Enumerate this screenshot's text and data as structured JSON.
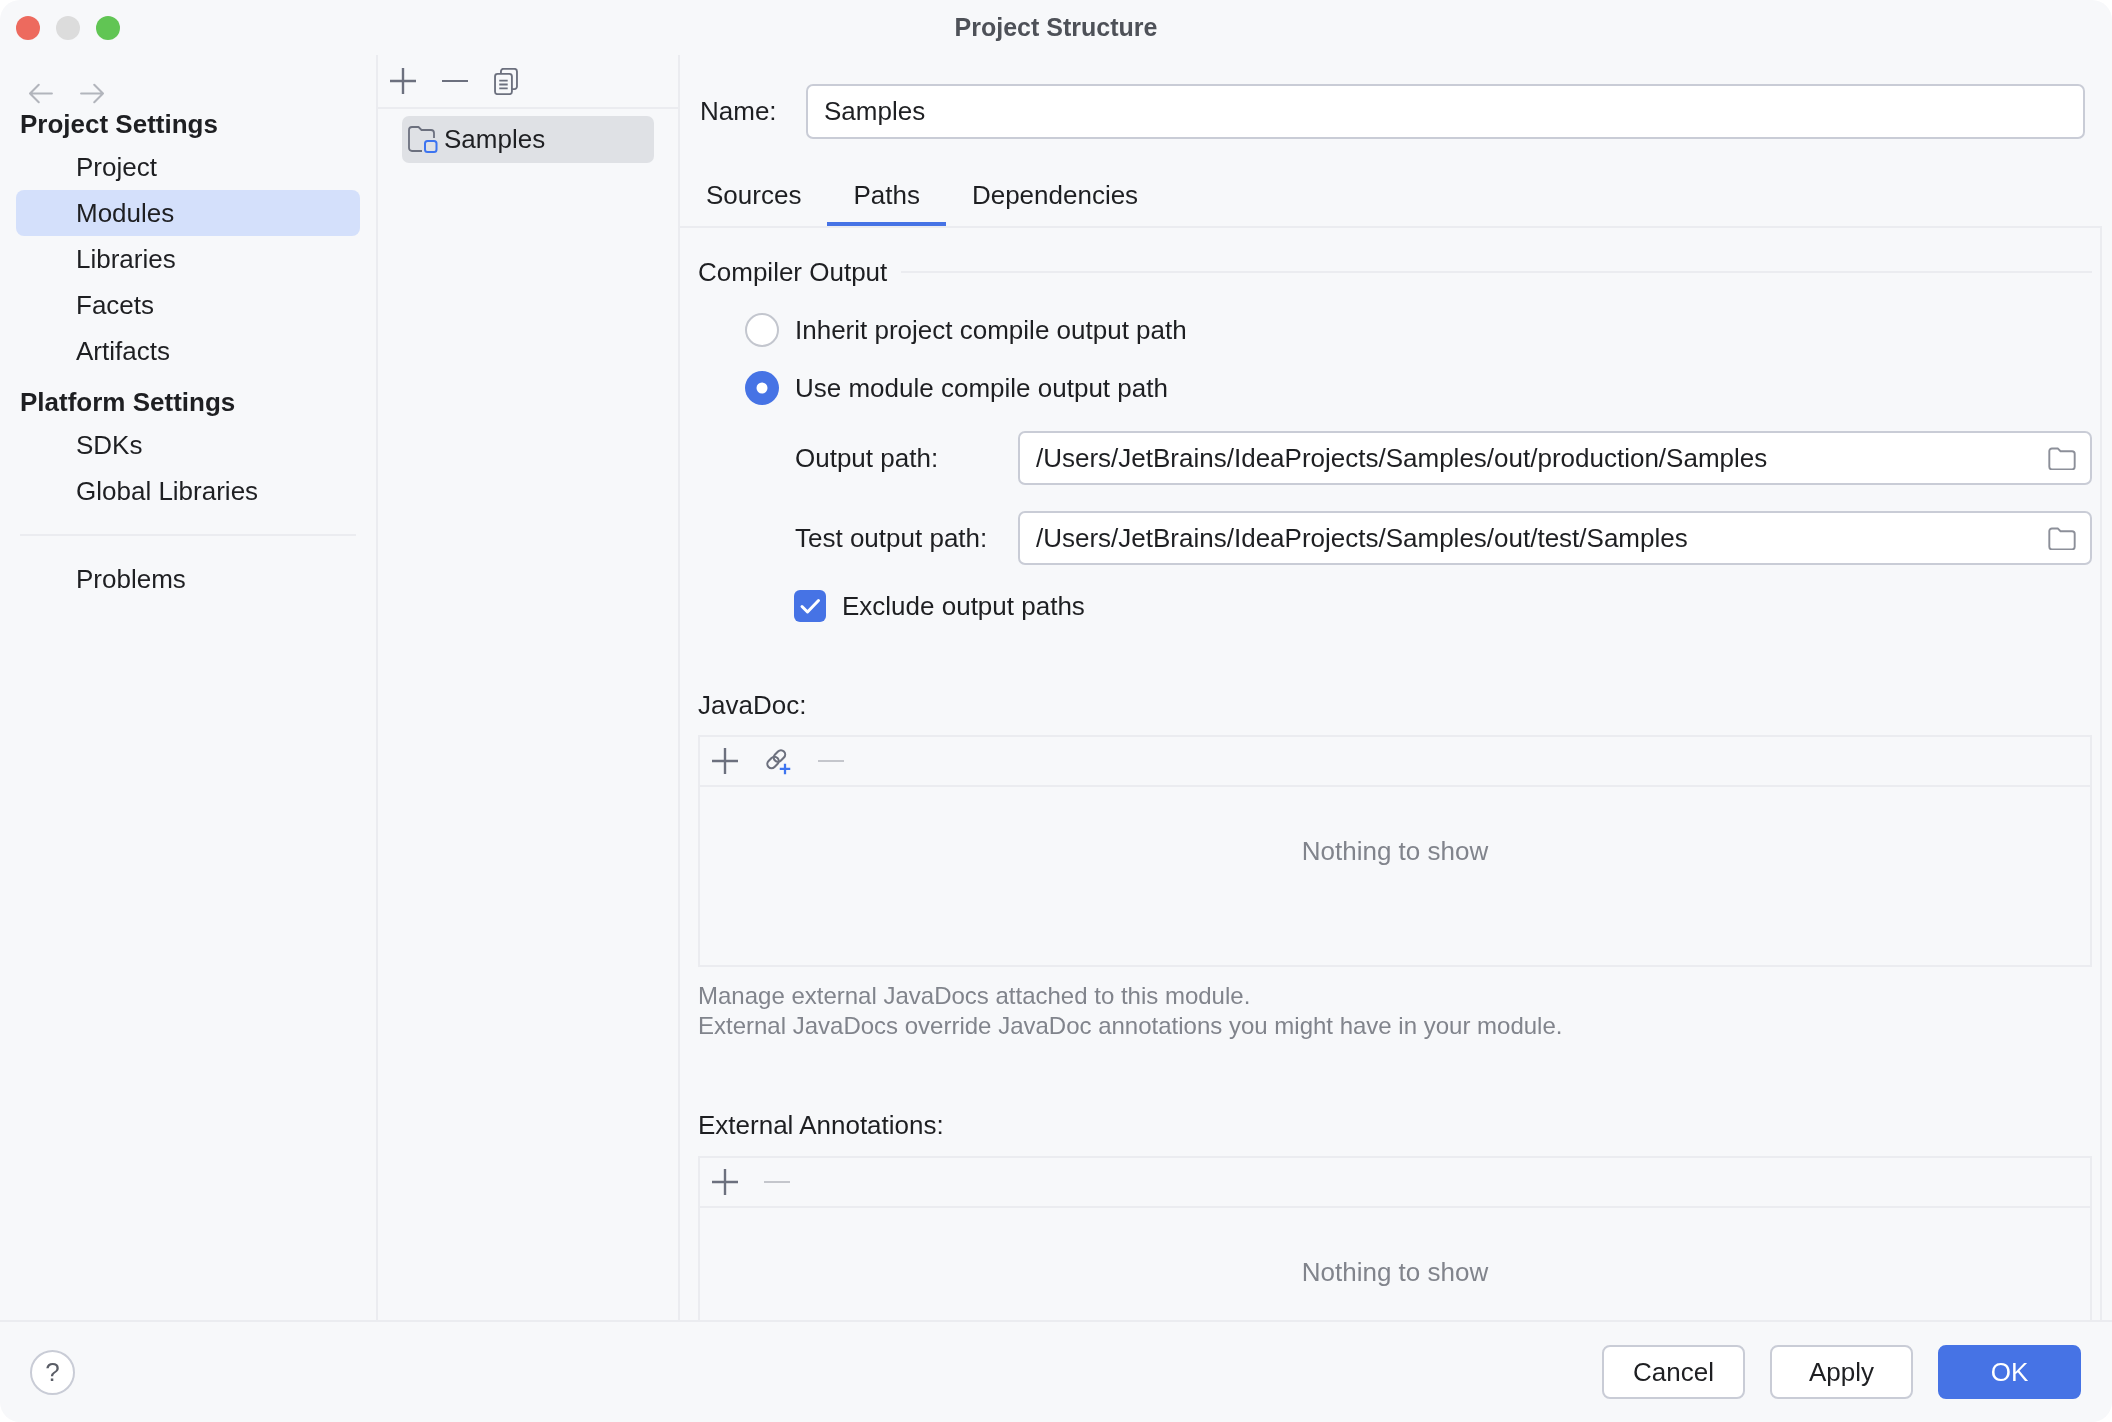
{
  "window": {
    "title": "Project Structure",
    "controls": [
      {
        "kind": "close",
        "disabled": false
      },
      {
        "kind": "minimize",
        "disabled": true
      },
      {
        "kind": "zoom",
        "disabled": false
      }
    ]
  },
  "navigation": [
    {
      "kind": "back",
      "disabled": true
    },
    {
      "kind": "forward",
      "disabled": true
    }
  ],
  "sidebar": {
    "sections": [
      {
        "heading": "Project Settings",
        "items": [
          {
            "label": "Project",
            "selected": false
          },
          {
            "label": "Modules",
            "selected": true
          },
          {
            "label": "Libraries",
            "selected": false
          },
          {
            "label": "Facets",
            "selected": false
          },
          {
            "label": "Artifacts",
            "selected": false
          }
        ]
      },
      {
        "heading": "Platform Settings",
        "items": [
          {
            "label": "SDKs",
            "selected": false
          },
          {
            "label": "Global Libraries",
            "selected": false
          }
        ]
      },
      {
        "items": [
          {
            "label": "Problems",
            "selected": false
          }
        ]
      }
    ]
  },
  "modules_panel": {
    "toolbar": [
      {
        "kind": "add",
        "disabled": false
      },
      {
        "kind": "remove",
        "disabled": false
      },
      {
        "kind": "copy",
        "disabled": false
      }
    ],
    "items": [
      {
        "label": "Samples",
        "selected": true
      }
    ]
  },
  "details": {
    "name_label": "Name:",
    "name_value": "Samples",
    "tabs": [
      {
        "label": "Sources",
        "selected": false
      },
      {
        "label": "Paths",
        "selected": true
      },
      {
        "label": "Dependencies",
        "selected": false
      }
    ],
    "compiler_output": {
      "title": "Compiler Output",
      "options": [
        {
          "label": "Inherit project compile output path",
          "selected": false
        },
        {
          "label": "Use module compile output path",
          "selected": true
        }
      ],
      "paths": [
        {
          "label": "Output path:",
          "value": "/Users/JetBrains/IdeaProjects/Samples/out/production/Samples"
        },
        {
          "label": "Test output path:",
          "value": "/Users/JetBrains/IdeaProjects/Samples/out/test/Samples"
        }
      ],
      "exclude": {
        "label": "Exclude output paths",
        "checked": true
      }
    },
    "javadoc": {
      "title": "JavaDoc:",
      "toolbar": [
        {
          "kind": "add",
          "disabled": false
        },
        {
          "kind": "link",
          "disabled": false
        },
        {
          "kind": "remove",
          "disabled": true
        }
      ],
      "empty_text": "Nothing to show",
      "help_lines": [
        "Manage external JavaDocs attached to this module.",
        "External JavaDocs override JavaDoc annotations you might have in your module."
      ]
    },
    "external_annotations": {
      "title": "External Annotations:",
      "toolbar": [
        {
          "kind": "add",
          "disabled": false
        },
        {
          "kind": "remove",
          "disabled": true
        }
      ],
      "empty_text": "Nothing to show"
    }
  },
  "footer": {
    "help_button": "?",
    "buttons": [
      {
        "label": "Cancel",
        "kind": "cancel"
      },
      {
        "label": "Apply",
        "kind": "apply"
      },
      {
        "label": "OK",
        "kind": "ok"
      }
    ]
  }
}
